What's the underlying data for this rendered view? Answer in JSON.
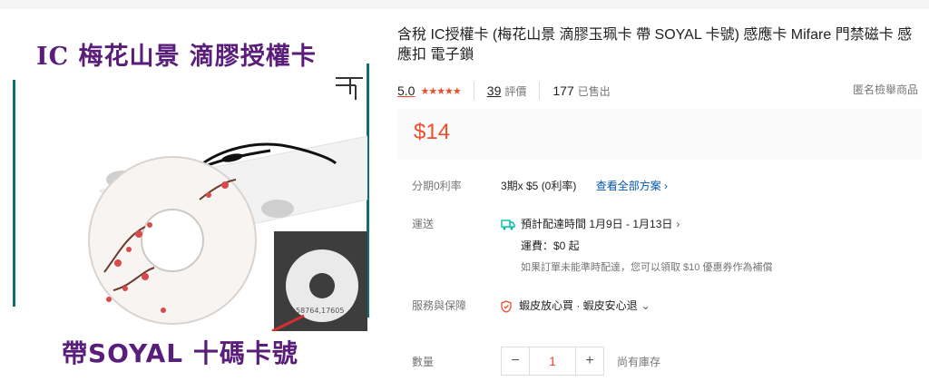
{
  "image": {
    "title": "IC  梅花山景  滴膠授權卡",
    "footer": "帶SOYAL  十碼卡號",
    "card_number": "58764,17605"
  },
  "product": {
    "title": "含稅 IC授權卡 (梅花山景 滴膠玉珮卡 帶 SOYAL 卡號) 感應卡 Mifare 門禁磁卡 感應扣 電子鎖",
    "rating": "5.0",
    "stars": "★★★★★",
    "reviews_count": "39",
    "reviews_unit": "評價",
    "sold_count": "177",
    "sold_unit": "已售出",
    "report": "匿名檢舉商品",
    "price": "$14"
  },
  "installment": {
    "label": "分期0利率",
    "value": "3期x $5 (0利率)",
    "link": "查看全部方案 ›"
  },
  "shipping": {
    "label": "運送",
    "estimate": "預計配達時間 1月9日 - 1月13日",
    "fee": "運費：$0 起",
    "note": "如果訂單未能準時配達，您可以領取 $10 優惠券作為補償"
  },
  "service": {
    "label": "服務與保障",
    "value": "蝦皮放心買 · 蝦皮安心退"
  },
  "quantity": {
    "label": "數量",
    "minus": "−",
    "value": "1",
    "plus": "+",
    "stock": "尚有庫存"
  },
  "colors": {
    "accent": "#ee4d2d",
    "link": "#0055aa",
    "shipping_green": "#00bfa5",
    "image_text": "#5a1e7a"
  }
}
